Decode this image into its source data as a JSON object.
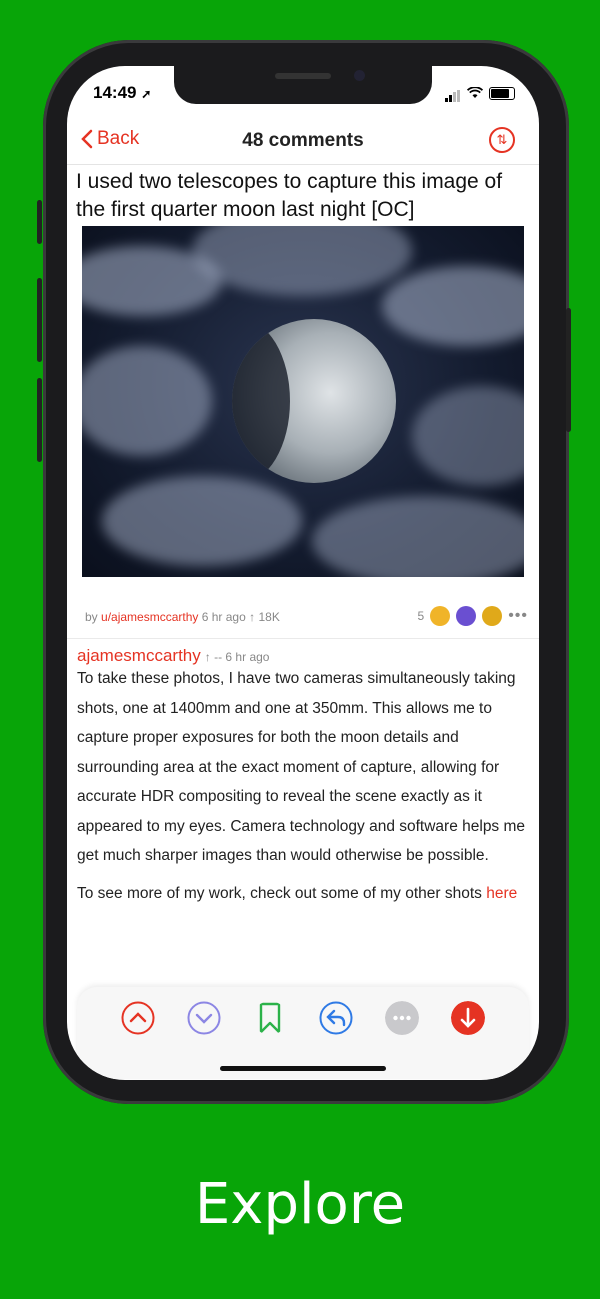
{
  "status": {
    "time": "14:49"
  },
  "nav": {
    "back_label": "Back",
    "title": "48 comments"
  },
  "post": {
    "title": "I used two telescopes to capture this image of the first quarter moon last night [OC]",
    "meta_prefix": "by",
    "author": "u/ajamesmccarthy",
    "age": "6 hr ago",
    "score": "↑ 18K",
    "award_count": "5"
  },
  "comment": {
    "author": "ajamesmccarthy",
    "info": "↑ -- 6 hr ago",
    "paragraph1": "To take these photos, I have two cameras simultaneously taking shots, one at 1400mm and one at 350mm. This allows me to capture proper exposures for both the moon details and surrounding area at the exact moment of capture, allowing for accurate HDR compositing to reveal the scene exactly as it appeared to my eyes. Camera technology and software helps me get much sharper images than would otherwise be possible.",
    "paragraph2_prefix": "To see more of my work, check out some of my other shots",
    "paragraph2_link": "here"
  },
  "toolbar": {
    "items": [
      "upvote-icon",
      "downvote-icon",
      "bookmark-icon",
      "reply-icon",
      "more-icon",
      "scroll-down-icon"
    ]
  },
  "caption": "Explore",
  "colors": {
    "background": "#08a508",
    "accent": "#e53323"
  }
}
